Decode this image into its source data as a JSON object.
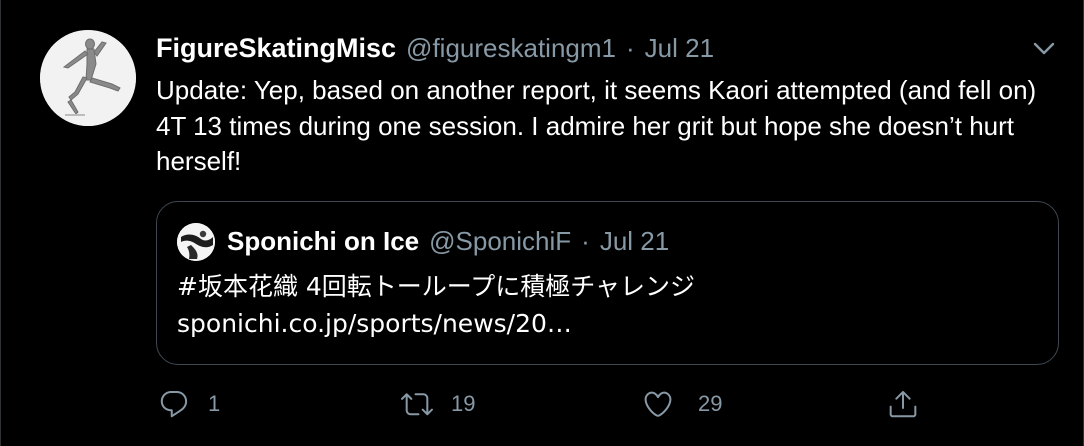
{
  "tweet": {
    "author_name": "FigureSkatingMisc",
    "author_handle": "@figureskatingm1",
    "separator": "·",
    "date": "Jul 21",
    "text": "Update: Yep, based on another report, it seems Kaori attempted (and fell on) 4T 13 times during one session. I admire her grit but hope she doesn’t hurt herself!"
  },
  "quote": {
    "author_name": "Sponichi on Ice",
    "author_handle": "@SponichiF",
    "separator": "·",
    "date": "Jul 21",
    "text_line1": "#坂本花織 4回転トーループに積極チャレンジ",
    "text_line2": "sponichi.co.jp/sports/news/20…"
  },
  "actions": {
    "reply_count": "1",
    "retweet_count": "19",
    "like_count": "29"
  },
  "colors": {
    "background": "#000000",
    "primary_text": "#ffffff",
    "secondary_text": "#8899a6",
    "border": "#3d4852"
  },
  "icons": [
    "chevron-down-icon",
    "reply-icon",
    "retweet-icon",
    "like-icon",
    "share-icon"
  ]
}
